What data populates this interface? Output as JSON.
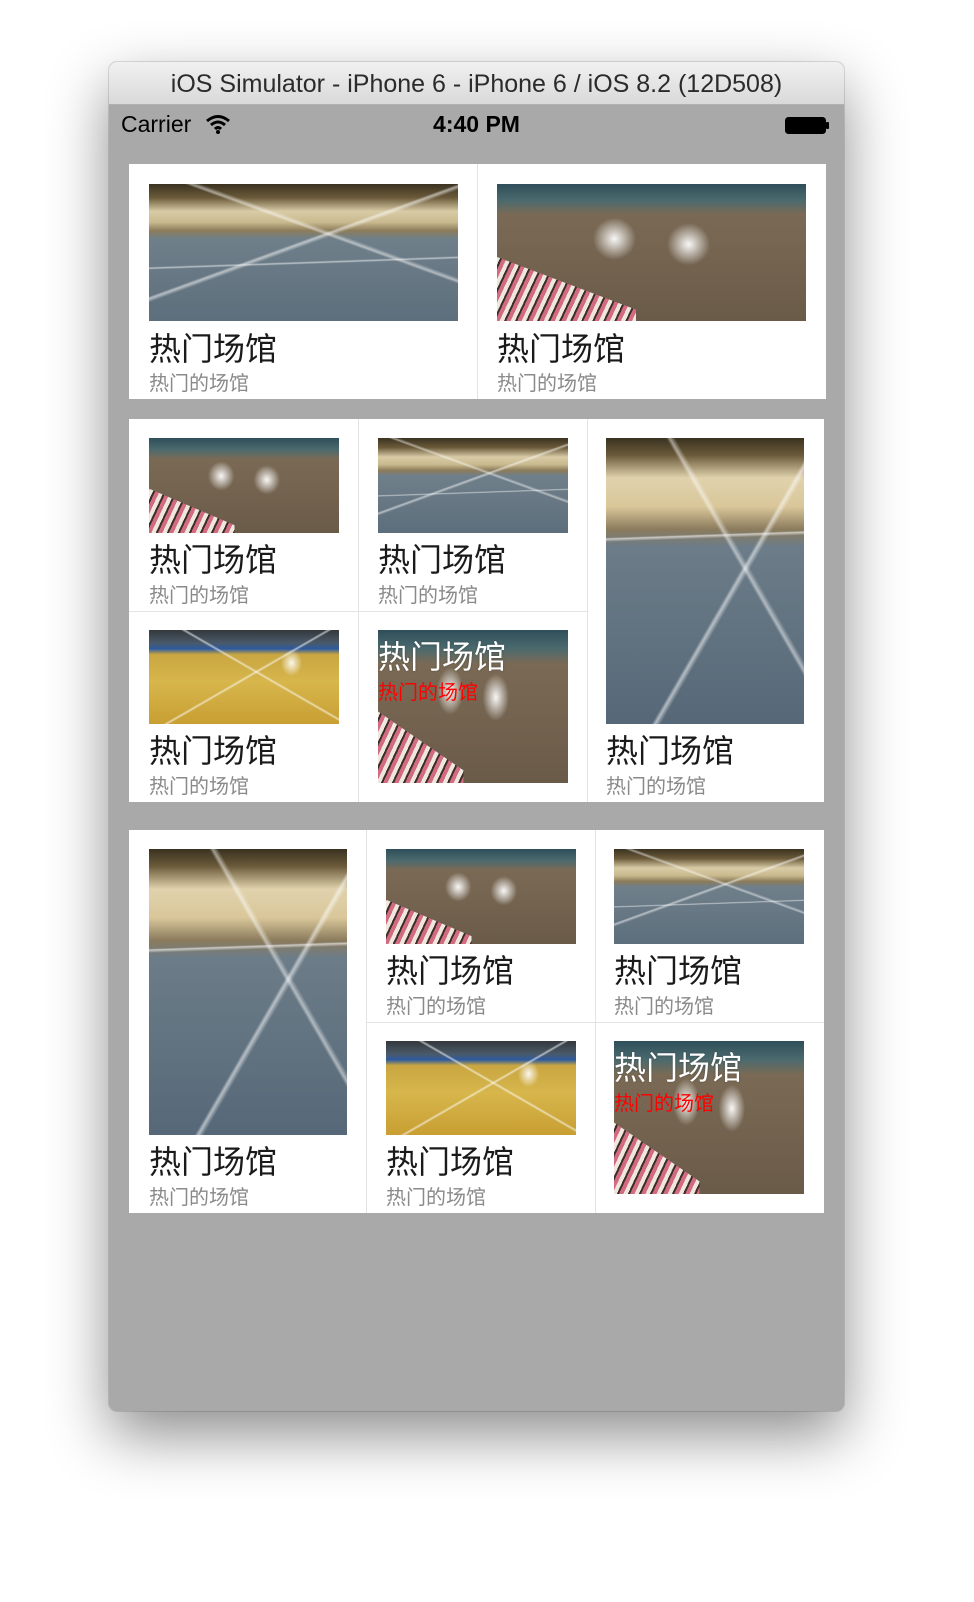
{
  "window": {
    "title": "iOS Simulator - iPhone 6 - iPhone 6 / iOS 8.2 (12D508)"
  },
  "statusbar": {
    "carrier": "Carrier",
    "time": "4:40 PM"
  },
  "venue": {
    "title": "热门场馆",
    "subtitle": "热门的场馆"
  },
  "colors": {
    "background": "#a9a9a9",
    "card": "#ffffff",
    "overlay_subtitle": "#ff0000"
  },
  "sections": [
    {
      "layout": "two-column",
      "items": 2
    },
    {
      "layout": "four-grid-plus-tall-right",
      "items": 5
    },
    {
      "layout": "tall-left-plus-four-grid",
      "items": 5
    }
  ]
}
